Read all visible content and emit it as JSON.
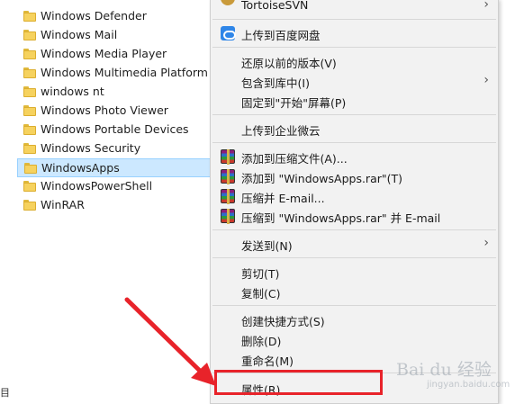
{
  "folders": [
    {
      "name": "Windows Defender"
    },
    {
      "name": "Windows Mail"
    },
    {
      "name": "Windows Media Player"
    },
    {
      "name": "Windows Multimedia Platform"
    },
    {
      "name": "windows nt"
    },
    {
      "name": "Windows Photo Viewer"
    },
    {
      "name": "Windows Portable Devices"
    },
    {
      "name": "Windows Security"
    },
    {
      "name": "WindowsApps",
      "selected": true
    },
    {
      "name": "WindowsPowerShell"
    },
    {
      "name": "WinRAR"
    }
  ],
  "left_edge_text": "目",
  "context_menu": {
    "items": [
      {
        "label": "TortoiseSVN",
        "icon": "tortoisesvn-icon",
        "submenu": true
      },
      {
        "label": "上传到百度网盘",
        "icon": "baidu-netdisk-icon"
      },
      {
        "label": "还原以前的版本(V)"
      },
      {
        "label": "包含到库中(I)",
        "submenu": true
      },
      {
        "label": "固定到\"开始\"屏幕(P)"
      },
      {
        "label": "上传到企业微云"
      },
      {
        "label": "添加到压缩文件(A)...",
        "icon": "winrar-icon"
      },
      {
        "label": "添加到 \"WindowsApps.rar\"(T)",
        "icon": "winrar-icon"
      },
      {
        "label": "压缩并 E-mail...",
        "icon": "winrar-icon"
      },
      {
        "label": "压缩到 \"WindowsApps.rar\" 并 E-mail",
        "icon": "winrar-icon"
      },
      {
        "label": "发送到(N)",
        "submenu": true
      },
      {
        "label": "剪切(T)"
      },
      {
        "label": "复制(C)"
      },
      {
        "label": "创建快捷方式(S)"
      },
      {
        "label": "删除(D)"
      },
      {
        "label": "重命名(M)"
      },
      {
        "label": "属性(R)",
        "highlighted": true
      }
    ],
    "submenu_arrow": "›"
  },
  "watermark": {
    "text": "Bai du 经验",
    "url": "jingyan.baidu.com"
  },
  "colors": {
    "highlight_box": "#e8232a",
    "arrow": "#e8232a",
    "selection": "#cce8ff",
    "menu_bg": "#f2f2f2"
  }
}
